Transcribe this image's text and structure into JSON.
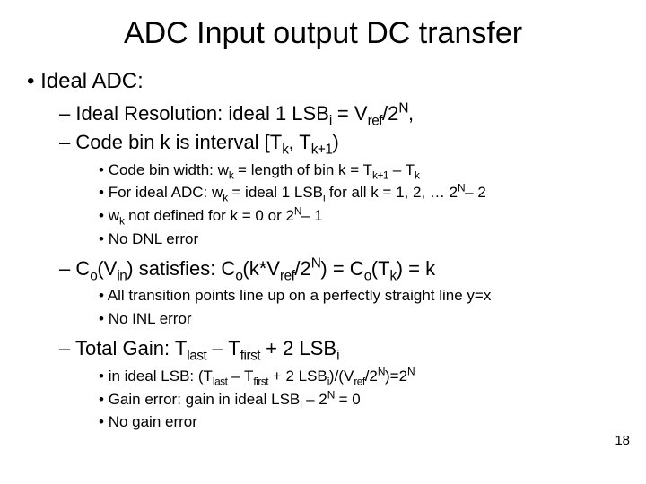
{
  "title": "ADC Input output DC transfer",
  "page_number": "18",
  "level1": {
    "item1": {
      "pre": "Ideal ADC:"
    }
  },
  "level2": {
    "res": {
      "pre": "Ideal Resolution: ideal 1 LSB",
      "sub1": "i",
      "mid1": " = V",
      "sub2": "ref",
      "mid2": "/2",
      "sup1": "N",
      "post": ","
    },
    "bin": {
      "pre": "Code bin k is interval [T",
      "sub1": "k",
      "mid1": ", T",
      "sub2": "k+1",
      "post": ")"
    },
    "co": {
      "pre": "C",
      "sub1": "o",
      "mid1": "(V",
      "sub2": "in",
      "mid2": ") satisfies: C",
      "sub3": "o",
      "mid3": "(k*V",
      "sub4": "ref",
      "mid4": "/2",
      "sup1": "N",
      "mid5": ") = C",
      "sub5": "o",
      "mid6": "(T",
      "sub6": "k",
      "post": ") = k"
    },
    "gain": {
      "pre": "Total Gain: T",
      "sub1": "last",
      "mid1": " – T",
      "sub2": "first",
      "mid2": " + 2 LSB",
      "sub3": "i"
    }
  },
  "level3_bin": {
    "w": {
      "pre": "Code bin width: w",
      "sub1": "k",
      "mid1": " = length of bin k = T",
      "sub2": "k+1",
      "mid2": " – T",
      "sub3": "k"
    },
    "ideal": {
      "pre": "For ideal ADC: w",
      "sub1": "k",
      "mid1": " = ideal 1 LSB",
      "sub2": "i",
      "mid2": " for all k = 1, 2, … 2",
      "sup1": "N",
      "post": "– 2"
    },
    "nd": {
      "pre": "w",
      "sub1": "k",
      "mid1": " not defined for k = 0 or 2",
      "sup1": "N",
      "post": "– 1"
    },
    "dnl": {
      "pre": "No DNL error"
    }
  },
  "level3_co": {
    "line": {
      "pre": "All transition points line up on a perfectly straight line y=x"
    },
    "inl": {
      "pre": "No INL error"
    }
  },
  "level3_gain": {
    "lsb": {
      "pre": "in ideal LSB: (T",
      "sub1": "last",
      "mid1": " – T",
      "sub2": "first",
      "mid2": " + 2 LSB",
      "sub3": "i",
      "mid3": ")/(V",
      "sub4": "ref",
      "mid4": "/2",
      "sup1": "N",
      "mid5": ")=2",
      "sup2": "N"
    },
    "ge": {
      "pre": "Gain error: gain in ideal LSB",
      "sub1": "i",
      "mid1": " – 2",
      "sup1": "N",
      "post": " = 0"
    },
    "ng": {
      "pre": "No gain error"
    }
  }
}
